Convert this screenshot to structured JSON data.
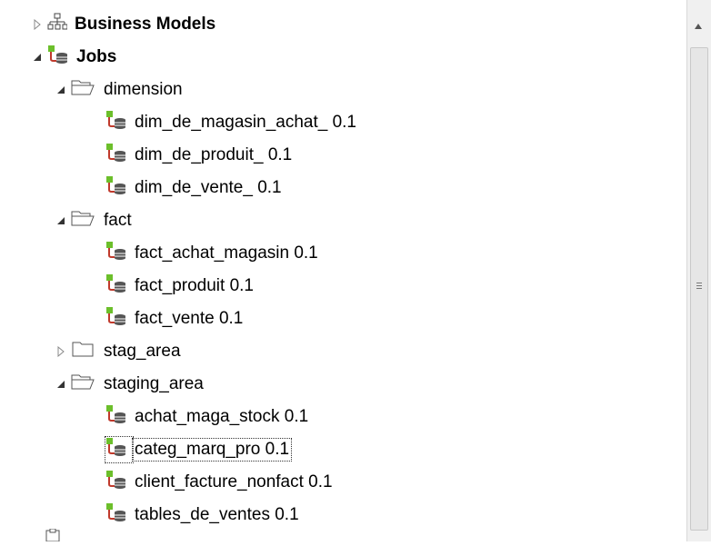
{
  "tree": {
    "business_models": {
      "label": "Business Models"
    },
    "jobs": {
      "label": "Jobs"
    },
    "folders": {
      "dimension": {
        "label": "dimension",
        "items": [
          "dim_de_magasin_achat_ 0.1",
          "dim_de_produit_ 0.1",
          "dim_de_vente_ 0.1"
        ]
      },
      "fact": {
        "label": "fact",
        "items": [
          "fact_achat_magasin 0.1",
          "fact_produit 0.1",
          "fact_vente 0.1"
        ]
      },
      "stag_area": {
        "label": "stag_area"
      },
      "staging_area": {
        "label": "staging_area",
        "items": [
          "achat_maga_stock 0.1",
          "categ_marq_pro 0.1",
          "client_facture_nonfact 0.1",
          "tables_de_ventes 0.1"
        ]
      }
    }
  },
  "colors": {
    "job_green": "#6cbf2b",
    "job_red": "#c0392b",
    "db_gray": "#555555"
  },
  "icons": {
    "expanded": "triangle-down-icon",
    "collapsed": "triangle-right-icon",
    "business_models": "hierarchy-icon",
    "job": "job-icon",
    "folder": "folder-icon"
  }
}
